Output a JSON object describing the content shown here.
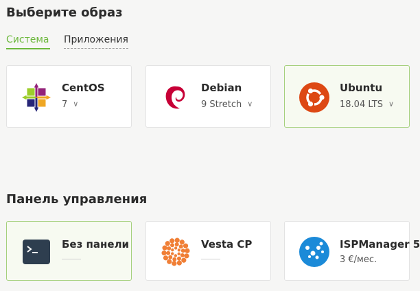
{
  "os_section": {
    "title": "Выберите образ",
    "tabs": [
      {
        "label": "Система",
        "active": true
      },
      {
        "label": "Приложения",
        "active": false
      }
    ],
    "cards": [
      {
        "name": "CentOS",
        "version": "7",
        "icon": "centos-icon",
        "selected": false
      },
      {
        "name": "Debian",
        "version": "9 Stretch",
        "icon": "debian-icon",
        "selected": false
      },
      {
        "name": "Ubuntu",
        "version": "18.04 LTS",
        "icon": "ubuntu-icon",
        "selected": true
      }
    ]
  },
  "panel_section": {
    "title": "Панель управления",
    "cards": [
      {
        "name": "Без панели",
        "price": "",
        "icon": "terminal-icon",
        "selected": true
      },
      {
        "name": "Vesta CP",
        "price": "",
        "icon": "vesta-icon",
        "selected": false
      },
      {
        "name": "ISPManager 5",
        "price": "3 €/мес.",
        "icon": "ispmanager-icon",
        "selected": false
      }
    ]
  },
  "colors": {
    "accent": "#6cb83c",
    "selected_border": "#a5d07d",
    "ubuntu": "#dd4814",
    "vesta": "#f07f36",
    "isp": "#1b8ad8",
    "debian": "#c70036",
    "terminal": "#2e3e4f"
  }
}
